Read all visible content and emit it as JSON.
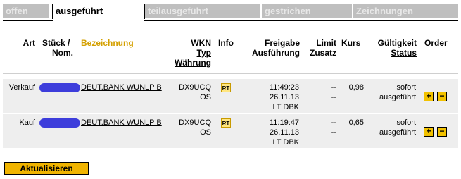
{
  "tabs": [
    {
      "label": "offen"
    },
    {
      "label": "ausgeführt"
    },
    {
      "label": "teilausgeführt"
    },
    {
      "label": "gestrichen"
    },
    {
      "label": "Zeichnungen"
    }
  ],
  "header": {
    "art": "Art",
    "stueck": "Stück /",
    "nom": "Nom.",
    "bezeichnung": "Bezeichnung",
    "wkn": "WKN",
    "typ": "Typ",
    "waehrung": "Währung",
    "info": "Info",
    "freigabe": "Freigabe",
    "ausfuehrung": "Ausführung",
    "limit": "Limit",
    "zusatz": "Zusatz",
    "kurs": "Kurs",
    "gueltigkeit": "Gültigkeit",
    "status": "Status",
    "order": "Order"
  },
  "rows": [
    {
      "art": "Verkauf",
      "bezeichnung": "DEUT.BANK WUNLP B",
      "wkn": "DX9UCQ",
      "typ": "OS",
      "info_badge": "RT",
      "time": "11:49:23",
      "date": "26.11.13",
      "venue": "LT DBK",
      "limit": "--",
      "zusatz": "--",
      "kurs": "0,98",
      "gueltigkeit": "sofort",
      "status": "ausgeführt",
      "plus": "+",
      "minus": "−"
    },
    {
      "art": "Kauf",
      "bezeichnung": "DEUT.BANK WUNLP B",
      "wkn": "DX9UCQ",
      "typ": "OS",
      "info_badge": "RT",
      "time": "11:19:47",
      "date": "26.11.13",
      "venue": "LT DBK",
      "limit": "--",
      "zusatz": "--",
      "kurs": "0,65",
      "gueltigkeit": "sofort",
      "status": "ausgeführt",
      "plus": "+",
      "minus": "−"
    }
  ],
  "update_button": "Aktualisieren",
  "colors": {
    "accent": "#f0b400",
    "tab_inactive": "#bfbfbf",
    "redaction": "#3d3ddb",
    "row_bg": "#eeeeee"
  }
}
